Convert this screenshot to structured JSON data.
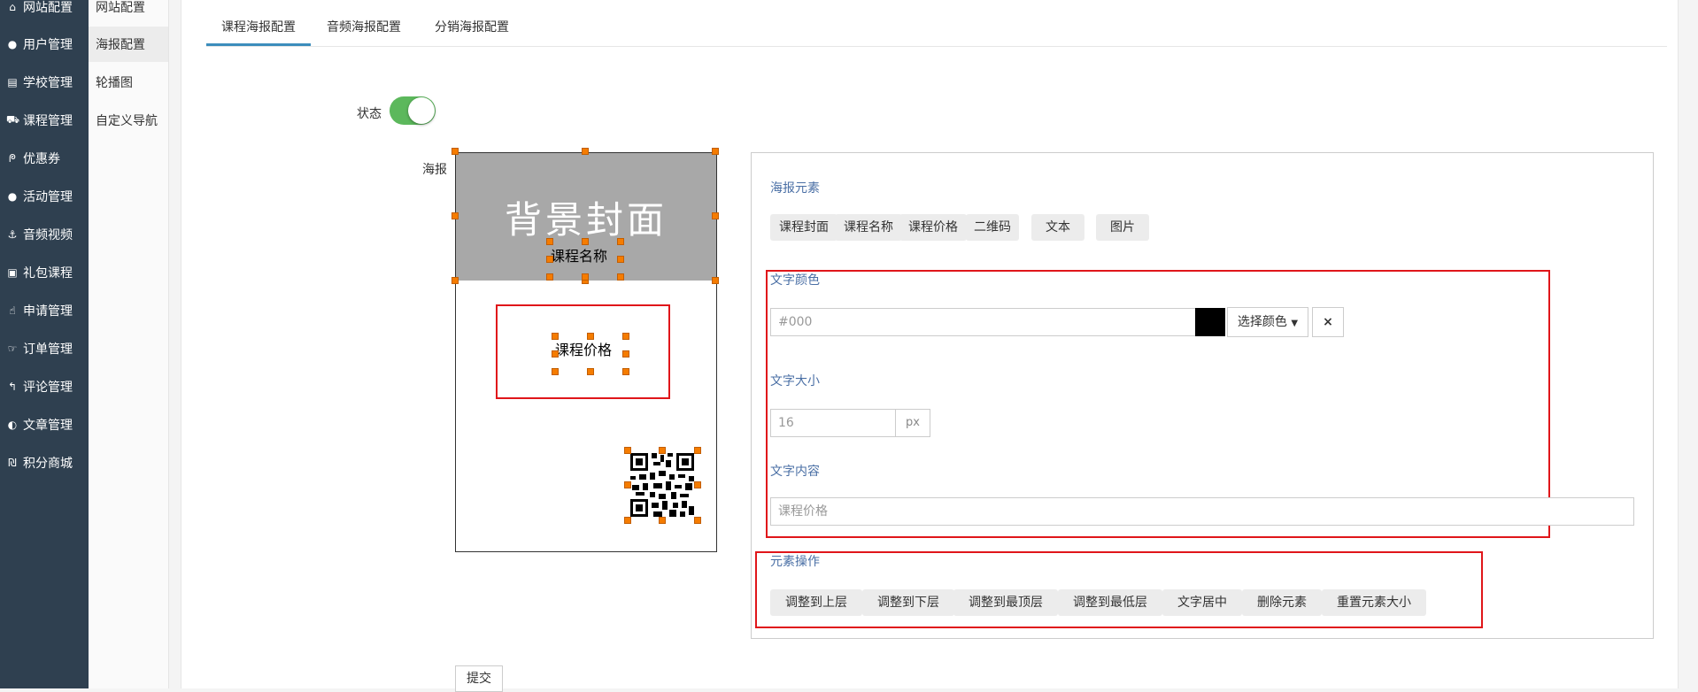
{
  "sidebar": {
    "items": [
      {
        "icon": "home-icon",
        "glyph": "⌂",
        "label": "网站配置"
      },
      {
        "icon": "user-icon",
        "glyph": "●",
        "label": "用户管理"
      },
      {
        "icon": "school-icon",
        "glyph": "▤",
        "label": "学校管理"
      },
      {
        "icon": "cart-icon",
        "glyph": "⛟",
        "label": "课程管理"
      },
      {
        "icon": "coupon-icon",
        "glyph": "ᖘ",
        "label": "优惠券"
      },
      {
        "icon": "group-icon",
        "glyph": "●",
        "label": "活动管理"
      },
      {
        "icon": "anchor-icon",
        "glyph": "⚓",
        "label": "音频视频"
      },
      {
        "icon": "gift-icon",
        "glyph": "▣",
        "label": "礼包课程"
      },
      {
        "icon": "hand-pointer-icon",
        "glyph": "☝",
        "label": "申请管理"
      },
      {
        "icon": "hand-right-icon",
        "glyph": "☞",
        "label": "订单管理"
      },
      {
        "icon": "reply-icon",
        "glyph": "↰",
        "label": "评论管理"
      },
      {
        "icon": "adjust-icon",
        "glyph": "◐",
        "label": "文章管理"
      },
      {
        "icon": "points-icon",
        "glyph": "₪",
        "label": "积分商城"
      }
    ]
  },
  "submenu": {
    "items": [
      {
        "label": "网站配置"
      },
      {
        "label": "海报配置"
      },
      {
        "label": "轮播图"
      },
      {
        "label": "自定义导航"
      }
    ]
  },
  "tabs": [
    {
      "label": "课程海报配置"
    },
    {
      "label": "音频海报配置"
    },
    {
      "label": "分销海报配置"
    }
  ],
  "form": {
    "status_label": "状态",
    "poster_label": "海报",
    "submit_label": "提交"
  },
  "poster": {
    "cover_text": "背景封面",
    "course_name": "课程名称",
    "course_price": "课程价格"
  },
  "editor": {
    "elements_title": "海报元素",
    "elements": [
      "课程封面",
      "课程名称",
      "课程价格",
      "二维码",
      "文本",
      "图片"
    ],
    "text_color_title": "文字颜色",
    "text_color_placeholder": "#000",
    "pick_color_label": "选择颜色",
    "clear_icon": "×",
    "font_size_title": "文字大小",
    "font_size_value": "16",
    "font_size_unit": "px",
    "text_content_title": "文字内容",
    "text_content_placeholder": "课程价格",
    "ops_title": "元素操作",
    "ops": [
      "调整到上层",
      "调整到下层",
      "调整到最顶层",
      "调整到最低层",
      "文字居中",
      "删除元素",
      "重置元素大小"
    ]
  },
  "colors": {
    "sidebar_bg": "#2f4050",
    "switch_on": "#5cb85c",
    "handle": "#f57c00",
    "highlight": "#e0161a",
    "tab_active": "#3c8dbc"
  }
}
